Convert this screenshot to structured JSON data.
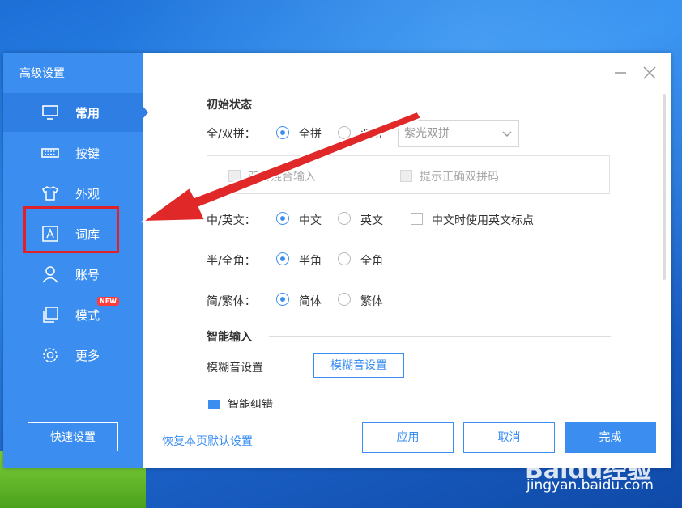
{
  "sidebar": {
    "title": "高级设置",
    "items": [
      {
        "label": "常用",
        "icon": "monitor-icon",
        "active": true
      },
      {
        "label": "按键",
        "icon": "keyboard-icon"
      },
      {
        "label": "外观",
        "icon": "tshirt-icon"
      },
      {
        "label": "词库",
        "icon": "dictionary-icon"
      },
      {
        "label": "账号",
        "icon": "user-icon"
      },
      {
        "label": "模式",
        "icon": "copy-icon",
        "badge": "NEW"
      },
      {
        "label": "更多",
        "icon": "gear-icon"
      }
    ],
    "quick_button": "快速设置"
  },
  "sections": {
    "initial_state": "初始状态",
    "smart_input": "智能输入"
  },
  "pinyin": {
    "label": "全/双拼：",
    "options": [
      "全拼",
      "双拼"
    ],
    "selected": "全拼",
    "dropdown_value": "紫光双拼",
    "sub_options": [
      "双拼混合输入",
      "提示正确双拼码"
    ]
  },
  "lang": {
    "label": "中/英文：",
    "options": [
      "中文",
      "英文"
    ],
    "selected": "中文",
    "checkbox": "中文时使用英文标点"
  },
  "width": {
    "label": "半/全角：",
    "options": [
      "半角",
      "全角"
    ],
    "selected": "半角"
  },
  "script": {
    "label": "简/繁体：",
    "options": [
      "简体",
      "繁体"
    ],
    "selected": "简体"
  },
  "fuzzy": {
    "label": "模糊音设置",
    "button": "模糊音设置"
  },
  "partial_row": "智能纠错",
  "footer": {
    "restore_link": "恢复本页默认设置",
    "apply": "应用",
    "cancel": "取消",
    "done": "完成"
  },
  "watermark": {
    "brand": "Baidu经验",
    "url": "jingyan.baidu.com"
  },
  "colors": {
    "accent": "#3b8ef0",
    "highlight": "#e0212a"
  }
}
